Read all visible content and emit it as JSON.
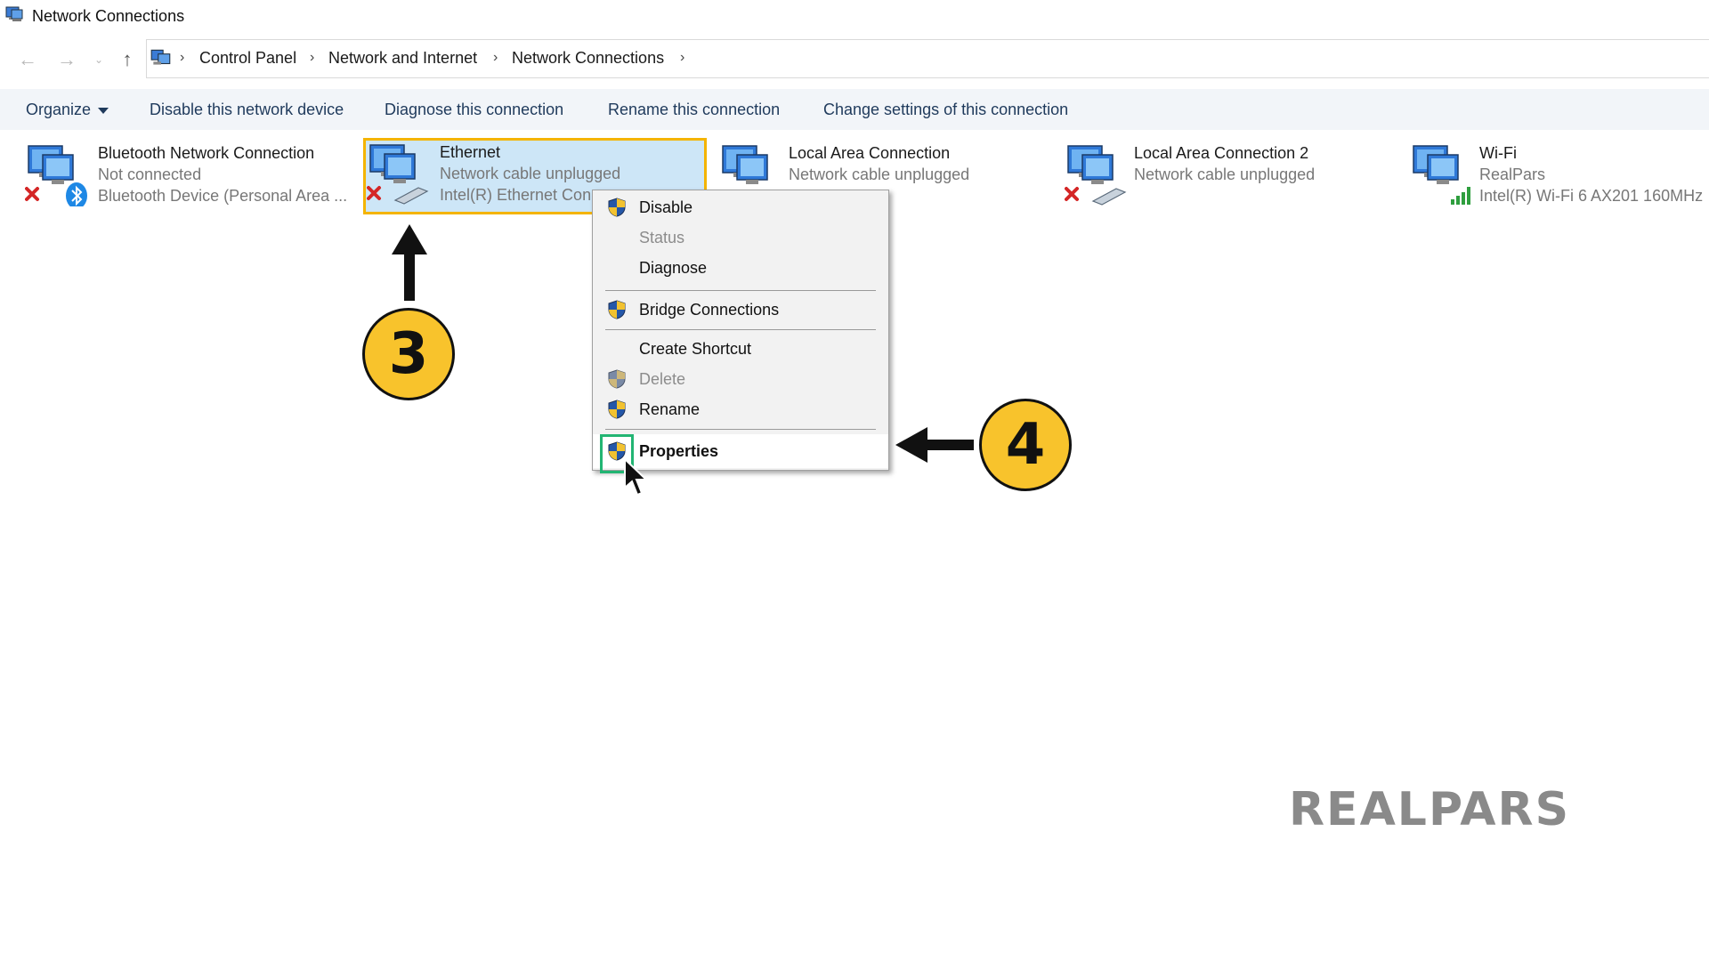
{
  "window": {
    "title": "Network Connections"
  },
  "breadcrumb": [
    "Control Panel",
    "Network and Internet",
    "Network Connections"
  ],
  "toolbar": {
    "organize": "Organize",
    "disable": "Disable this network device",
    "diagnose": "Diagnose this connection",
    "rename": "Rename this connection",
    "change": "Change settings of this connection"
  },
  "connections": [
    {
      "name": "Bluetooth Network Connection",
      "status": "Not connected",
      "device": "Bluetooth Device (Personal Area ...",
      "icon": "bluetooth-network-icon"
    },
    {
      "name": "Ethernet",
      "status": "Network cable unplugged",
      "device": "Intel(R) Ethernet Con",
      "icon": "ethernet-network-icon",
      "selected": true
    },
    {
      "name": "Local Area Connection",
      "status": "Network cable unplugged",
      "device": "",
      "icon": "lan-network-icon"
    },
    {
      "name": "Local Area Connection 2",
      "status": "Network cable unplugged",
      "device": "",
      "icon": "lan-network-icon"
    },
    {
      "name": "Wi-Fi",
      "status": "RealPars",
      "device": "Intel(R) Wi-Fi 6 AX201 160MHz",
      "icon": "wifi-network-icon"
    }
  ],
  "context_menu": {
    "disable": "Disable",
    "status": "Status",
    "diagnose": "Diagnose",
    "bridge": "Bridge Connections",
    "shortcut": "Create Shortcut",
    "delete": "Delete",
    "rename": "Rename",
    "properties": "Properties"
  },
  "annotations": {
    "step3": "3",
    "step4": "4"
  },
  "watermark": "REALPARS",
  "colors": {
    "badge": "#f8c32c",
    "selection_border": "#f4b400",
    "highlight_box": "#22b573",
    "selection_fill": "#cde6f7"
  }
}
